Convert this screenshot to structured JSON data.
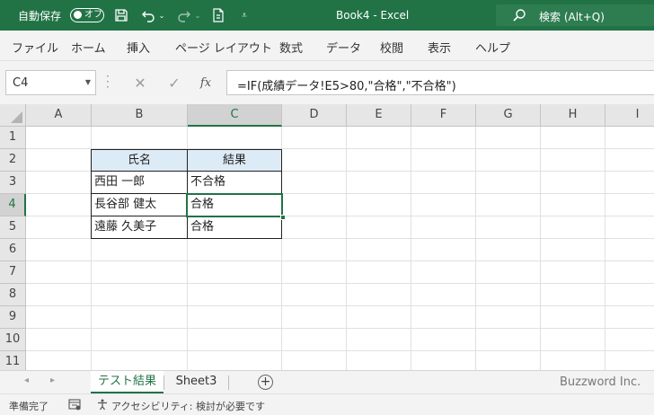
{
  "titlebar": {
    "autosave_label": "自動保存",
    "autosave_state": "オフ",
    "doc_title": "Book4  -  Excel",
    "search_text": "検索 (Alt+Q)",
    "accent": "#217346"
  },
  "menu": [
    "ファイル",
    "ホーム",
    "挿入",
    "ページ レイアウト",
    "数式",
    "データ",
    "校閲",
    "表示",
    "ヘルプ"
  ],
  "formula_bar": {
    "name_box": "C4",
    "formula": "=IF(成績データ!E5>80,\"合格\",\"不合格\")",
    "fx_label": "fx"
  },
  "columns": [
    "A",
    "B",
    "C",
    "D",
    "E",
    "F",
    "G",
    "H",
    "I"
  ],
  "rows": [
    "1",
    "2",
    "3",
    "4",
    "5",
    "6",
    "7",
    "8",
    "9",
    "10",
    "11"
  ],
  "table": {
    "headers": [
      "氏名",
      "結果"
    ],
    "rows": [
      [
        "西田 一郎",
        "不合格"
      ],
      [
        "長谷部 健太",
        "合格"
      ],
      [
        "遠藤 久美子",
        "合格"
      ]
    ]
  },
  "sheets": {
    "tabs": [
      "テスト結果",
      "Sheet3"
    ],
    "active": "テスト結果",
    "watermark": "Buzzword Inc."
  },
  "status": {
    "ready": "準備完了",
    "accessibility": "アクセシビリティ: 検討が必要です"
  }
}
